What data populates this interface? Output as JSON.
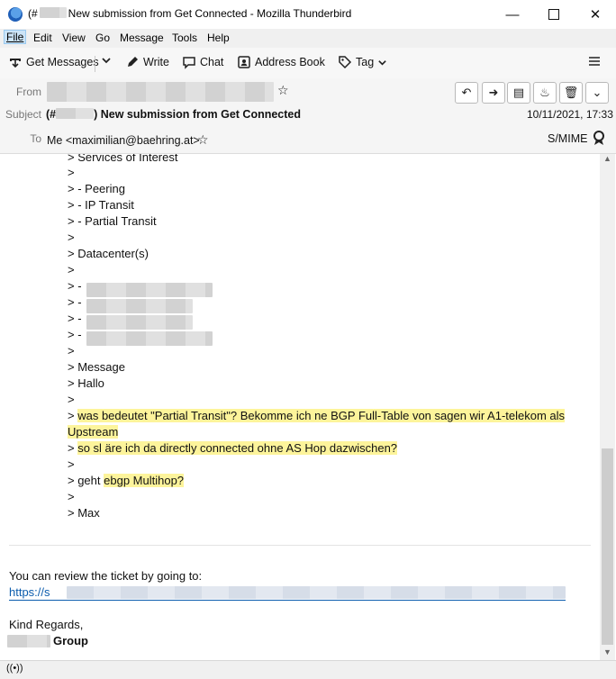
{
  "window": {
    "title_prefix": "(#",
    "title_suffix": "New submission from Get Connected - Mozilla Thunderbird"
  },
  "menu": [
    "File",
    "Edit",
    "View",
    "Go",
    "Message",
    "Tools",
    "Help"
  ],
  "toolbar": {
    "get_messages": "Get Messages",
    "write": "Write",
    "chat": "Chat",
    "address_book": "Address Book",
    "tag": "Tag"
  },
  "header": {
    "from_label": "From",
    "subject_label": "Subject",
    "to_label": "To",
    "subject_prefix": "(#",
    "subject_suffix": ") New submission from Get Connected",
    "date": "10/11/2021, 17:33",
    "to_value": "Me <maximilian@baehring.at>",
    "smime": "S/MIME"
  },
  "body": {
    "lines": [
      "> Services of Interest",
      ">",
      "> - Peering",
      "> - IP Transit",
      "> - Partial Transit",
      ">",
      "> Datacenter(s)",
      ">",
      "> -",
      "> -",
      "> -",
      "> -",
      ">",
      "> Message",
      "> Hallo",
      ">",
      ">"
    ],
    "hl1a": "was bedeutet \"Partial Transit\"? Bekomme ich ne BGP Full-Table von sagen wir A1-telekom als",
    "hl1b": "Upstream",
    "hl2_prefix": ">",
    "hl2": "so sl äre ich da directly connected ohne AS Hop dazwischen?",
    "line_after1": ">",
    "geht_prefix": "> geht",
    "geht_hl": "ebgp Multihop?",
    "line_after2": ">",
    "max": "> Max",
    "review": "You can review the ticket by going to:",
    "link": "https://s",
    "regards": "Kind Regards,",
    "group": "Group"
  },
  "colors": {
    "highlight": "#fdf49b",
    "link": "#0b5cad",
    "accent": "#cce4f7"
  }
}
